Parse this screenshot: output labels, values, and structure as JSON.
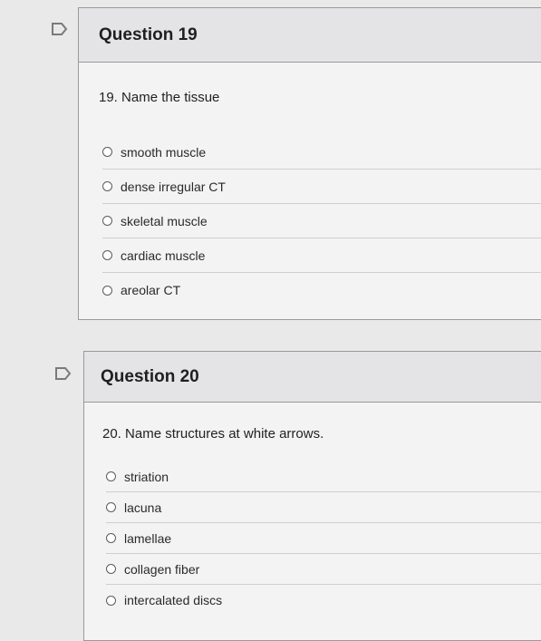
{
  "questions": [
    {
      "title": "Question 19",
      "prompt": "19. Name the tissue",
      "options": [
        "smooth muscle",
        "dense irregular CT",
        "skeletal muscle",
        "cardiac muscle",
        "areolar CT"
      ]
    },
    {
      "title": "Question 20",
      "prompt": "20. Name structures at white arrows.",
      "options": [
        "striation",
        "lacuna",
        "lamellae",
        "collagen fiber",
        "intercalated discs"
      ]
    }
  ],
  "icons": {
    "flag": "flag-icon"
  },
  "colors": {
    "flag_stroke": "#7a7a7c"
  }
}
